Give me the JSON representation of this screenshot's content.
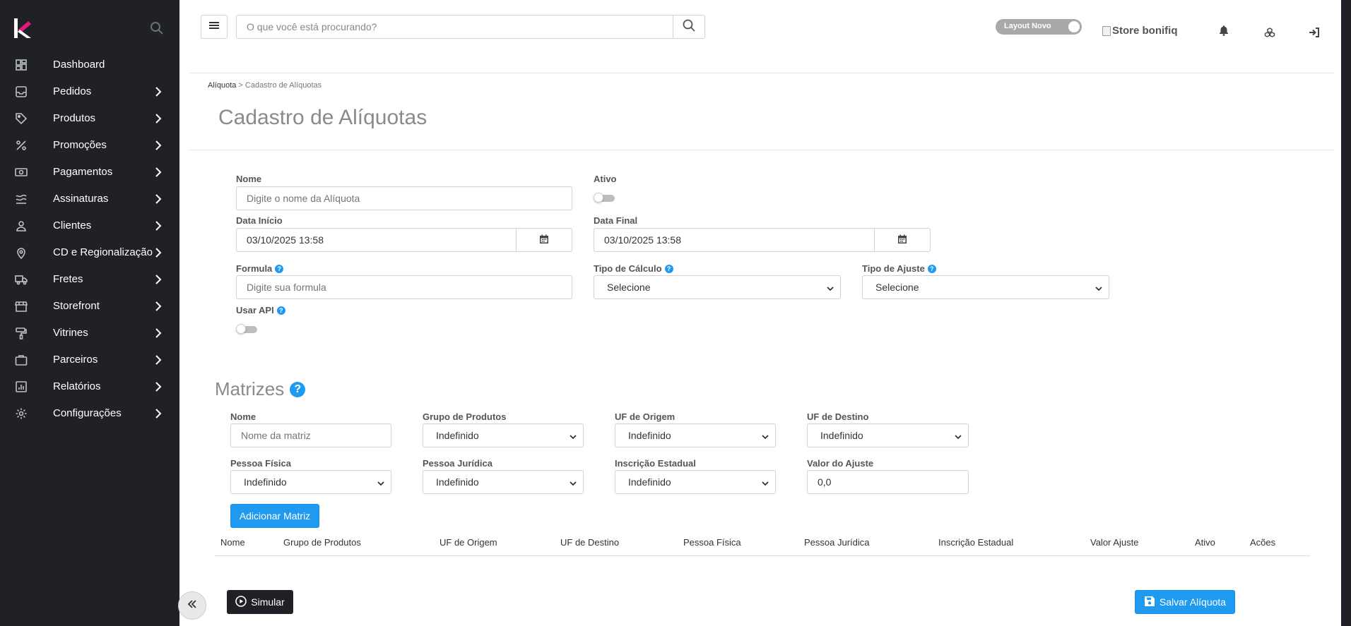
{
  "sidebar": {
    "items": [
      {
        "label": "Dashboard",
        "icon": "dashboard-grid-icon",
        "has_children": false
      },
      {
        "label": "Pedidos",
        "icon": "inbox-tray-icon",
        "has_children": true
      },
      {
        "label": "Produtos",
        "icon": "tag-icon",
        "has_children": true
      },
      {
        "label": "Promoções",
        "icon": "percent-icon",
        "has_children": true
      },
      {
        "label": "Pagamentos",
        "icon": "money-bill-icon",
        "has_children": true
      },
      {
        "label": "Assinaturas",
        "icon": "waves-icon",
        "has_children": true
      },
      {
        "label": "Clientes",
        "icon": "user-icon",
        "has_children": true
      },
      {
        "label": "CD e Regionalização",
        "icon": "map-pin-icon",
        "has_children": true
      },
      {
        "label": "Fretes",
        "icon": "truck-icon",
        "has_children": true
      },
      {
        "label": "Storefront",
        "icon": "storefront-icon",
        "has_children": true
      },
      {
        "label": "Vitrines",
        "icon": "paint-roller-icon",
        "has_children": true
      },
      {
        "label": "Parceiros",
        "icon": "briefcase-icon",
        "has_children": true
      },
      {
        "label": "Relatórios",
        "icon": "chart-report-icon",
        "has_children": true
      },
      {
        "label": "Configurações",
        "icon": "gear-icon",
        "has_children": true
      }
    ]
  },
  "header": {
    "search_placeholder": "O que você está procurando?",
    "layout_toggle_label": "Layout Novo",
    "store_image_alt": "Store bonifiq"
  },
  "breadcrumb": {
    "first": "Alíquota",
    "separator": " > ",
    "current": "Cadastro de Alíquotas"
  },
  "page_title": "Cadastro de Alíquotas",
  "form": {
    "nome_label": "Nome",
    "nome_placeholder": "Digite o nome da Alíquota",
    "ativo_label": "Ativo",
    "data_inicio_label": "Data Início",
    "data_inicio_value": "03/10/2025 13:58",
    "data_final_label": "Data Final",
    "data_final_value": "03/10/2025 13:58",
    "formula_label": "Formula",
    "formula_placeholder": "Digite sua formula",
    "tipo_calculo_label": "Tipo de Cálculo",
    "tipo_calculo_value": "Selecione",
    "tipo_ajuste_label": "Tipo de Ajuste",
    "tipo_ajuste_value": "Selecione",
    "usar_api_label": "Usar API"
  },
  "matrizes": {
    "title": "Matrizes",
    "nome_label": "Nome",
    "nome_placeholder": "Nome da matriz",
    "grupo_label": "Grupo de Produtos",
    "grupo_value": "Indefinido",
    "uf_origem_label": "UF de Origem",
    "uf_origem_value": "Indefinido",
    "uf_destino_label": "UF de Destino",
    "uf_destino_value": "Indefinido",
    "pf_label": "Pessoa Física",
    "pf_value": "Indefinido",
    "pj_label": "Pessoa Jurídica",
    "pj_value": "Indefinido",
    "ie_label": "Inscrição Estadual",
    "ie_value": "Indefinido",
    "valor_label": "Valor do Ajuste",
    "valor_value": "0,0",
    "add_button": "Adicionar Matriz",
    "table_headers": [
      "Nome",
      "Grupo de Produtos",
      "UF de Origem",
      "UF de Destino",
      "Pessoa Física",
      "Pessoa Jurídica",
      "Inscrição Estadual",
      "Valor Ajuste",
      "Ativo",
      "Acões"
    ]
  },
  "footer": {
    "simular_label": "Simular",
    "salvar_label": "Salvar Alíquota"
  },
  "colors": {
    "sidebar_bg": "#1f2126",
    "accent_blue": "#1e9bf0",
    "logo_pink": "#e6197e",
    "title_gray": "#8a8a8a"
  }
}
